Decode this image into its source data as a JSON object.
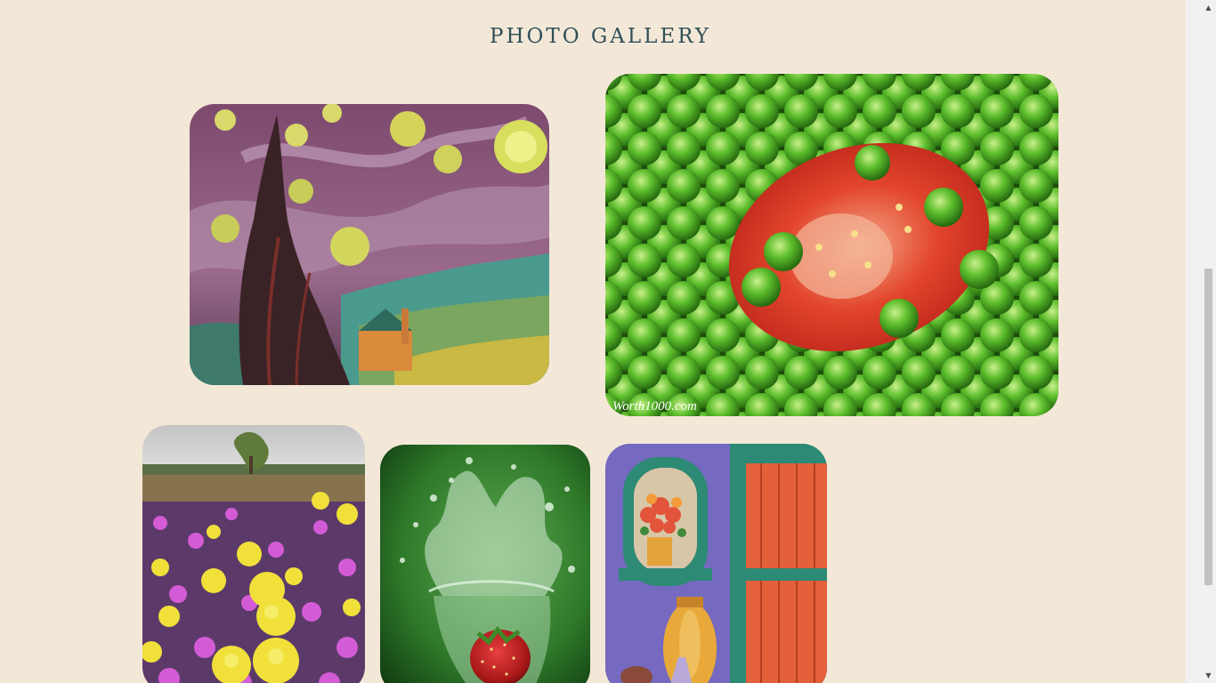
{
  "page": {
    "title": "PHOTO GALLERY",
    "background": "#f3e8d8",
    "title_color": "#2f4f57"
  },
  "gallery": [
    {
      "name": "starry-night-painting-photo",
      "subject": "Starry night painting with cypress tree",
      "caption": ""
    },
    {
      "name": "peas-and-tomato-photo",
      "subject": "Green peas with a tomato slice",
      "caption": "Worth1000.com"
    },
    {
      "name": "wildflower-field-photo",
      "subject": "Field of yellow and purple wildflowers",
      "caption": ""
    },
    {
      "name": "strawberry-splash-photo",
      "subject": "Strawberry splashing into a glass of water",
      "caption": ""
    },
    {
      "name": "window-door-painting-photo",
      "subject": "Painting of a window with flowers and an orange door",
      "caption": ""
    }
  ],
  "scrollbar": {
    "up_icon": "triangle-up-icon",
    "down_icon": "triangle-down-icon",
    "up_glyph": "▲",
    "down_glyph": "▼"
  }
}
